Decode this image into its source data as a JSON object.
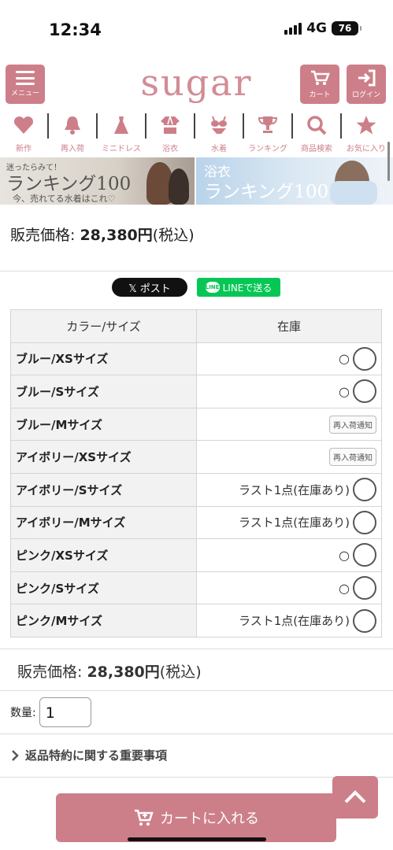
{
  "status_bar": {
    "time": "12:34",
    "network": "4G",
    "battery": "76"
  },
  "header": {
    "menu_label": "メニュー",
    "logo": "sugar",
    "cart_label": "カート",
    "login_label": "ログイン",
    "accent_color": "#cd7f89"
  },
  "categories": [
    {
      "label": "新作",
      "icon": "heart-icon"
    },
    {
      "label": "再入荷",
      "icon": "bell-icon"
    },
    {
      "label": "ミニドレス",
      "icon": "dress-icon"
    },
    {
      "label": "浴衣",
      "icon": "yukata-icon"
    },
    {
      "label": "水着",
      "icon": "swimsuit-icon"
    },
    {
      "label": "ランキング",
      "icon": "trophy-icon"
    },
    {
      "label": "商品検索",
      "icon": "search-icon"
    },
    {
      "label": "お気に入り",
      "icon": "star-icon"
    }
  ],
  "banners": {
    "b1_small": "迷ったらみて！",
    "b1_big": "ランキング100",
    "b1_sub": "今、売れてる水着はこれ♡",
    "b2_line1": "浴衣",
    "b2_big": "ランキング100"
  },
  "price": {
    "label": "販売価格:",
    "amount": "28,380円",
    "tax": "(税込)"
  },
  "share": {
    "x_label": "𝕏 ポスト",
    "line_label": "LINEで送る",
    "line_icon": "LINE"
  },
  "stock_table": {
    "headers": [
      "カラー/サイズ",
      "在庫"
    ],
    "rows": [
      {
        "name": "ブルー/XSサイズ",
        "stock_text": "○",
        "type": "cart"
      },
      {
        "name": "ブルー/Sサイズ",
        "stock_text": "○",
        "type": "cart"
      },
      {
        "name": "ブルー/Mサイズ",
        "stock_text": "再入荷通知",
        "type": "restock"
      },
      {
        "name": "アイボリー/XSサイズ",
        "stock_text": "再入荷通知",
        "type": "restock"
      },
      {
        "name": "アイボリー/Sサイズ",
        "stock_text": "ラスト1点(在庫あり)",
        "type": "cart"
      },
      {
        "name": "アイボリー/Mサイズ",
        "stock_text": "ラスト1点(在庫あり)",
        "type": "cart"
      },
      {
        "name": "ピンク/XSサイズ",
        "stock_text": "○",
        "type": "cart"
      },
      {
        "name": "ピンク/Sサイズ",
        "stock_text": "○",
        "type": "cart"
      },
      {
        "name": "ピンク/Mサイズ",
        "stock_text": "ラスト1点(在庫あり)",
        "type": "cart"
      }
    ]
  },
  "quantity": {
    "label": "数量:",
    "value": "1"
  },
  "returns_link": "返品特約に関する重要事項",
  "add_to_cart": "カートに入れる"
}
